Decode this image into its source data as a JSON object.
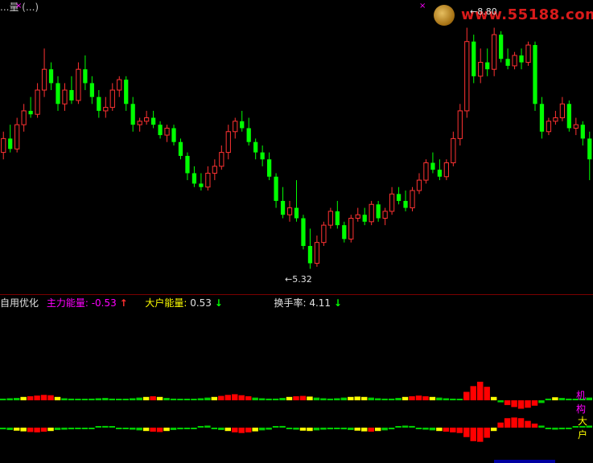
{
  "chart_data": [
    {
      "type": "candlestick",
      "title": "",
      "annotations": {
        "high": {
          "label": "8.80",
          "arrow": "←"
        },
        "low": {
          "label": "5.32",
          "arrow": "←"
        }
      },
      "candles": [
        [
          7.0,
          7.3,
          6.9,
          7.2
        ],
        [
          7.2,
          7.4,
          7.0,
          7.05
        ],
        [
          7.05,
          7.5,
          7.0,
          7.4
        ],
        [
          7.4,
          7.7,
          7.3,
          7.6
        ],
        [
          7.6,
          7.8,
          7.5,
          7.55
        ],
        [
          7.55,
          8.0,
          7.5,
          7.9
        ],
        [
          7.9,
          8.5,
          7.8,
          8.2
        ],
        [
          8.2,
          8.3,
          7.9,
          8.0
        ],
        [
          8.0,
          8.1,
          7.6,
          7.7
        ],
        [
          7.7,
          8.0,
          7.6,
          7.9
        ],
        [
          7.9,
          8.1,
          7.7,
          7.75
        ],
        [
          7.75,
          8.3,
          7.7,
          8.2
        ],
        [
          8.2,
          8.4,
          7.9,
          8.0
        ],
        [
          8.0,
          8.1,
          7.7,
          7.8
        ],
        [
          7.8,
          7.9,
          7.5,
          7.6
        ],
        [
          7.6,
          7.8,
          7.5,
          7.65
        ],
        [
          7.65,
          8.0,
          7.6,
          7.9
        ],
        [
          7.9,
          8.1,
          7.8,
          8.05
        ],
        [
          8.05,
          8.1,
          7.6,
          7.7
        ],
        [
          7.7,
          7.8,
          7.3,
          7.4
        ],
        [
          7.4,
          7.5,
          7.3,
          7.45
        ],
        [
          7.45,
          7.6,
          7.4,
          7.5
        ],
        [
          7.5,
          7.6,
          7.35,
          7.4
        ],
        [
          7.4,
          7.45,
          7.2,
          7.25
        ],
        [
          7.25,
          7.4,
          7.15,
          7.35
        ],
        [
          7.35,
          7.4,
          7.1,
          7.15
        ],
        [
          7.15,
          7.2,
          6.9,
          6.95
        ],
        [
          6.95,
          7.0,
          6.6,
          6.7
        ],
        [
          6.7,
          6.8,
          6.5,
          6.55
        ],
        [
          6.55,
          6.7,
          6.45,
          6.5
        ],
        [
          6.5,
          6.8,
          6.45,
          6.7
        ],
        [
          6.7,
          6.9,
          6.6,
          6.8
        ],
        [
          6.8,
          7.1,
          6.75,
          7.0
        ],
        [
          7.0,
          7.4,
          6.9,
          7.3
        ],
        [
          7.3,
          7.5,
          7.2,
          7.45
        ],
        [
          7.45,
          7.6,
          7.3,
          7.35
        ],
        [
          7.35,
          7.5,
          7.1,
          7.15
        ],
        [
          7.15,
          7.2,
          6.9,
          7.0
        ],
        [
          7.0,
          7.1,
          6.8,
          6.9
        ],
        [
          6.9,
          7.0,
          6.6,
          6.65
        ],
        [
          6.65,
          6.7,
          6.2,
          6.3
        ],
        [
          6.3,
          6.5,
          6.05,
          6.1
        ],
        [
          6.1,
          6.3,
          6.0,
          6.2
        ],
        [
          6.2,
          6.6,
          6.0,
          6.05
        ],
        [
          6.05,
          6.1,
          5.6,
          5.65
        ],
        [
          5.65,
          5.9,
          5.32,
          5.4
        ],
        [
          5.4,
          5.8,
          5.35,
          5.7
        ],
        [
          5.7,
          6.0,
          5.65,
          5.95
        ],
        [
          5.95,
          6.2,
          5.9,
          6.15
        ],
        [
          6.15,
          6.3,
          5.9,
          5.95
        ],
        [
          5.95,
          6.0,
          5.7,
          5.75
        ],
        [
          5.75,
          6.1,
          5.7,
          6.05
        ],
        [
          6.05,
          6.2,
          6.0,
          6.1
        ],
        [
          6.1,
          6.2,
          5.95,
          6.0
        ],
        [
          6.0,
          6.3,
          5.95,
          6.25
        ],
        [
          6.25,
          6.3,
          6.0,
          6.05
        ],
        [
          6.05,
          6.2,
          5.95,
          6.15
        ],
        [
          6.15,
          6.5,
          6.1,
          6.4
        ],
        [
          6.4,
          6.5,
          6.25,
          6.3
        ],
        [
          6.3,
          6.45,
          6.15,
          6.2
        ],
        [
          6.2,
          6.5,
          6.15,
          6.45
        ],
        [
          6.45,
          6.7,
          6.4,
          6.6
        ],
        [
          6.6,
          6.9,
          6.55,
          6.85
        ],
        [
          6.85,
          7.0,
          6.7,
          6.75
        ],
        [
          6.75,
          6.9,
          6.6,
          6.65
        ],
        [
          6.65,
          6.9,
          6.6,
          6.85
        ],
        [
          6.85,
          7.3,
          6.8,
          7.2
        ],
        [
          7.2,
          7.7,
          7.1,
          7.6
        ],
        [
          7.6,
          8.8,
          7.5,
          8.6
        ],
        [
          8.6,
          8.7,
          8.0,
          8.1
        ],
        [
          8.1,
          8.5,
          8.0,
          8.3
        ],
        [
          8.3,
          8.5,
          8.1,
          8.2
        ],
        [
          8.2,
          8.8,
          8.1,
          8.7
        ],
        [
          8.7,
          8.75,
          8.3,
          8.35
        ],
        [
          8.35,
          8.5,
          8.2,
          8.25
        ],
        [
          8.25,
          8.45,
          8.2,
          8.4
        ],
        [
          8.4,
          8.5,
          8.2,
          8.3
        ],
        [
          8.3,
          8.6,
          8.25,
          8.55
        ],
        [
          8.55,
          8.6,
          7.6,
          7.7
        ],
        [
          7.7,
          7.8,
          7.2,
          7.3
        ],
        [
          7.3,
          7.5,
          7.25,
          7.45
        ],
        [
          7.45,
          7.6,
          7.4,
          7.5
        ],
        [
          7.5,
          7.8,
          7.45,
          7.7
        ],
        [
          7.7,
          7.75,
          7.3,
          7.35
        ],
        [
          7.35,
          7.5,
          7.25,
          7.4
        ],
        [
          7.4,
          7.45,
          7.1,
          7.2
        ],
        [
          7.2,
          7.3,
          6.6,
          6.9
        ]
      ]
    },
    {
      "type": "bar",
      "title": "主力能量",
      "series_name": "机构",
      "values": [
        0.5,
        0.6,
        0.7,
        1.0,
        1.2,
        1.4,
        1.6,
        1.5,
        1.0,
        0.6,
        0.5,
        0.4,
        0.4,
        0.5,
        0.6,
        0.7,
        0.5,
        0.4,
        0.4,
        0.6,
        0.8,
        1.0,
        1.2,
        1.0,
        0.7,
        0.5,
        0.4,
        0.4,
        0.4,
        0.6,
        0.8,
        1.0,
        1.3,
        1.6,
        1.8,
        1.5,
        1.2,
        0.8,
        0.6,
        0.5,
        0.5,
        0.7,
        1.0,
        1.2,
        1.3,
        1.1,
        0.8,
        0.6,
        0.5,
        0.6,
        0.8,
        1.0,
        1.1,
        1.0,
        0.8,
        0.6,
        0.5,
        0.5,
        0.7,
        1.0,
        1.2,
        1.4,
        1.2,
        1.0,
        0.8,
        0.6,
        0.5,
        0.4,
        2.5,
        4.2,
        5.5,
        4.0,
        1.0,
        -0.6,
        -1.4,
        -2.0,
        -2.5,
        -2.2,
        -1.6,
        -0.8,
        0.5,
        0.9,
        0.7,
        0.5,
        0.4,
        0.5,
        0.8
      ],
      "colors": [
        "#ff0000",
        "#ffff00",
        "#00cc00"
      ]
    },
    {
      "type": "bar",
      "title": "大户能量",
      "series_name": "大户",
      "values": [
        -0.5,
        -0.7,
        -0.9,
        -1.1,
        -1.3,
        -1.4,
        -1.2,
        -1.0,
        -0.7,
        -0.6,
        -0.5,
        -0.4,
        -0.3,
        -0.3,
        0.4,
        0.5,
        0.4,
        -0.3,
        -0.4,
        -0.6,
        -0.8,
        -1.0,
        -1.2,
        -1.3,
        -1.0,
        -0.7,
        -0.5,
        -0.4,
        -0.3,
        0.4,
        0.6,
        -0.4,
        -0.7,
        -1.0,
        -1.4,
        -1.6,
        -1.4,
        -1.1,
        -0.8,
        -0.6,
        0.4,
        0.5,
        -0.4,
        -0.6,
        -0.9,
        -1.0,
        -0.8,
        -0.6,
        -0.5,
        -0.4,
        -0.5,
        -0.7,
        -0.9,
        -1.1,
        -1.2,
        -1.0,
        -0.8,
        -0.5,
        0.4,
        0.6,
        0.5,
        -0.4,
        -0.6,
        -0.8,
        -1.0,
        -1.2,
        -1.4,
        -1.6,
        -2.8,
        -4.0,
        -4.2,
        -3.0,
        -1.0,
        1.5,
        2.8,
        3.0,
        2.8,
        2.0,
        1.2,
        0.6,
        -0.4,
        -0.6,
        -0.5,
        -0.4,
        0.4,
        0.5,
        0.6
      ],
      "colors": [
        "#ff0000",
        "#ffff00",
        "#00cc00"
      ]
    }
  ],
  "top_label": "...量 (...)",
  "markers": [
    "×",
    "×"
  ],
  "watermark": "www.55188.com",
  "indicator": {
    "title": "自用优化",
    "main_energy_label": "主力能量:",
    "main_energy_value": "-0.53",
    "main_arrow": "↑",
    "big_energy_label": "大户能量:",
    "big_energy_value": "0.53",
    "big_arrow": "↓",
    "turnover_label": "换手率:",
    "turnover_value": "4.11",
    "turnover_arrow": "↓"
  },
  "side_labels": {
    "institution": "机构",
    "big_holder": "大户"
  },
  "colors": {
    "up": "#ff3232",
    "down": "#00ff00",
    "background": "#000000",
    "divider": "#7a0000"
  }
}
